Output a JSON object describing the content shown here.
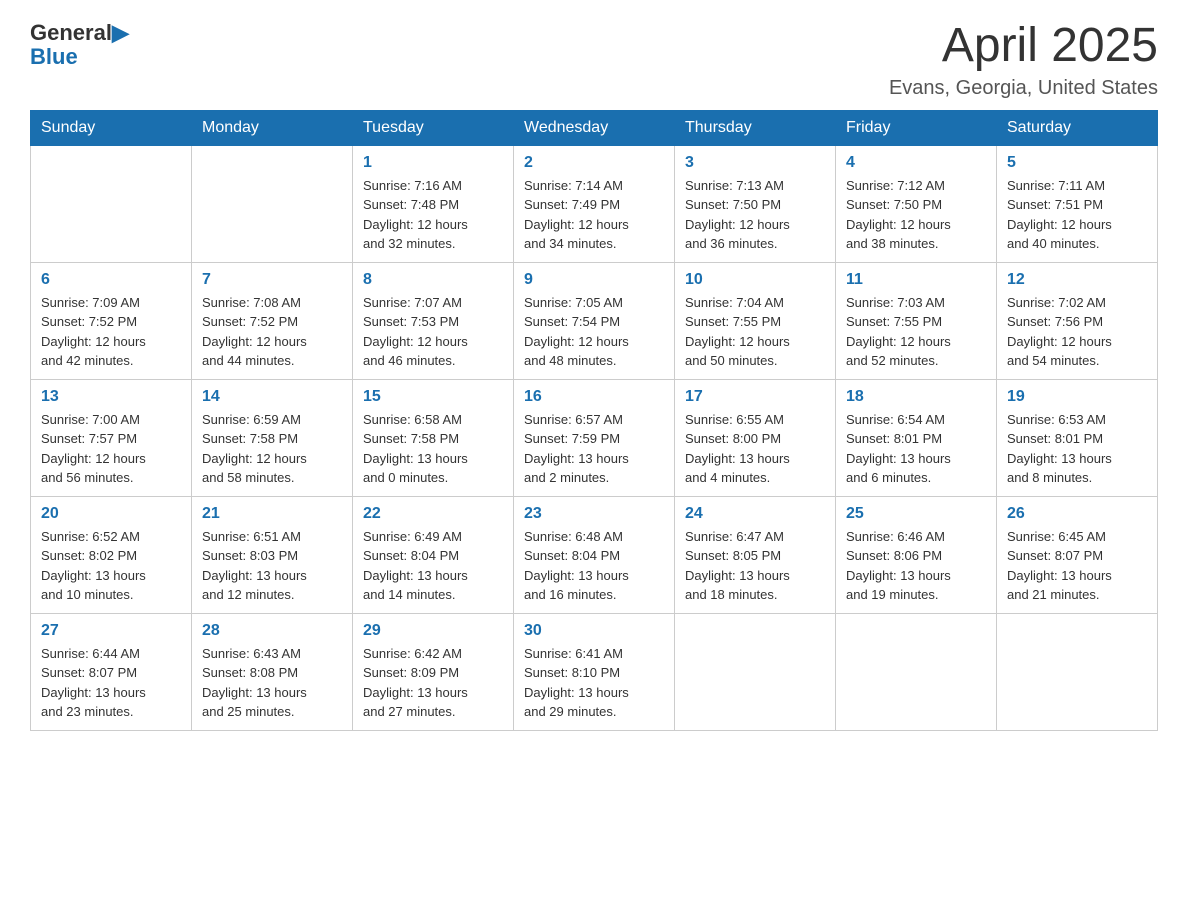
{
  "header": {
    "logo_general": "General",
    "logo_blue": "Blue",
    "month_title": "April 2025",
    "location": "Evans, Georgia, United States"
  },
  "days_of_week": [
    "Sunday",
    "Monday",
    "Tuesday",
    "Wednesday",
    "Thursday",
    "Friday",
    "Saturday"
  ],
  "weeks": [
    [
      {
        "day": "",
        "info": ""
      },
      {
        "day": "",
        "info": ""
      },
      {
        "day": "1",
        "info": "Sunrise: 7:16 AM\nSunset: 7:48 PM\nDaylight: 12 hours\nand 32 minutes."
      },
      {
        "day": "2",
        "info": "Sunrise: 7:14 AM\nSunset: 7:49 PM\nDaylight: 12 hours\nand 34 minutes."
      },
      {
        "day": "3",
        "info": "Sunrise: 7:13 AM\nSunset: 7:50 PM\nDaylight: 12 hours\nand 36 minutes."
      },
      {
        "day": "4",
        "info": "Sunrise: 7:12 AM\nSunset: 7:50 PM\nDaylight: 12 hours\nand 38 minutes."
      },
      {
        "day": "5",
        "info": "Sunrise: 7:11 AM\nSunset: 7:51 PM\nDaylight: 12 hours\nand 40 minutes."
      }
    ],
    [
      {
        "day": "6",
        "info": "Sunrise: 7:09 AM\nSunset: 7:52 PM\nDaylight: 12 hours\nand 42 minutes."
      },
      {
        "day": "7",
        "info": "Sunrise: 7:08 AM\nSunset: 7:52 PM\nDaylight: 12 hours\nand 44 minutes."
      },
      {
        "day": "8",
        "info": "Sunrise: 7:07 AM\nSunset: 7:53 PM\nDaylight: 12 hours\nand 46 minutes."
      },
      {
        "day": "9",
        "info": "Sunrise: 7:05 AM\nSunset: 7:54 PM\nDaylight: 12 hours\nand 48 minutes."
      },
      {
        "day": "10",
        "info": "Sunrise: 7:04 AM\nSunset: 7:55 PM\nDaylight: 12 hours\nand 50 minutes."
      },
      {
        "day": "11",
        "info": "Sunrise: 7:03 AM\nSunset: 7:55 PM\nDaylight: 12 hours\nand 52 minutes."
      },
      {
        "day": "12",
        "info": "Sunrise: 7:02 AM\nSunset: 7:56 PM\nDaylight: 12 hours\nand 54 minutes."
      }
    ],
    [
      {
        "day": "13",
        "info": "Sunrise: 7:00 AM\nSunset: 7:57 PM\nDaylight: 12 hours\nand 56 minutes."
      },
      {
        "day": "14",
        "info": "Sunrise: 6:59 AM\nSunset: 7:58 PM\nDaylight: 12 hours\nand 58 minutes."
      },
      {
        "day": "15",
        "info": "Sunrise: 6:58 AM\nSunset: 7:58 PM\nDaylight: 13 hours\nand 0 minutes."
      },
      {
        "day": "16",
        "info": "Sunrise: 6:57 AM\nSunset: 7:59 PM\nDaylight: 13 hours\nand 2 minutes."
      },
      {
        "day": "17",
        "info": "Sunrise: 6:55 AM\nSunset: 8:00 PM\nDaylight: 13 hours\nand 4 minutes."
      },
      {
        "day": "18",
        "info": "Sunrise: 6:54 AM\nSunset: 8:01 PM\nDaylight: 13 hours\nand 6 minutes."
      },
      {
        "day": "19",
        "info": "Sunrise: 6:53 AM\nSunset: 8:01 PM\nDaylight: 13 hours\nand 8 minutes."
      }
    ],
    [
      {
        "day": "20",
        "info": "Sunrise: 6:52 AM\nSunset: 8:02 PM\nDaylight: 13 hours\nand 10 minutes."
      },
      {
        "day": "21",
        "info": "Sunrise: 6:51 AM\nSunset: 8:03 PM\nDaylight: 13 hours\nand 12 minutes."
      },
      {
        "day": "22",
        "info": "Sunrise: 6:49 AM\nSunset: 8:04 PM\nDaylight: 13 hours\nand 14 minutes."
      },
      {
        "day": "23",
        "info": "Sunrise: 6:48 AM\nSunset: 8:04 PM\nDaylight: 13 hours\nand 16 minutes."
      },
      {
        "day": "24",
        "info": "Sunrise: 6:47 AM\nSunset: 8:05 PM\nDaylight: 13 hours\nand 18 minutes."
      },
      {
        "day": "25",
        "info": "Sunrise: 6:46 AM\nSunset: 8:06 PM\nDaylight: 13 hours\nand 19 minutes."
      },
      {
        "day": "26",
        "info": "Sunrise: 6:45 AM\nSunset: 8:07 PM\nDaylight: 13 hours\nand 21 minutes."
      }
    ],
    [
      {
        "day": "27",
        "info": "Sunrise: 6:44 AM\nSunset: 8:07 PM\nDaylight: 13 hours\nand 23 minutes."
      },
      {
        "day": "28",
        "info": "Sunrise: 6:43 AM\nSunset: 8:08 PM\nDaylight: 13 hours\nand 25 minutes."
      },
      {
        "day": "29",
        "info": "Sunrise: 6:42 AM\nSunset: 8:09 PM\nDaylight: 13 hours\nand 27 minutes."
      },
      {
        "day": "30",
        "info": "Sunrise: 6:41 AM\nSunset: 8:10 PM\nDaylight: 13 hours\nand 29 minutes."
      },
      {
        "day": "",
        "info": ""
      },
      {
        "day": "",
        "info": ""
      },
      {
        "day": "",
        "info": ""
      }
    ]
  ]
}
